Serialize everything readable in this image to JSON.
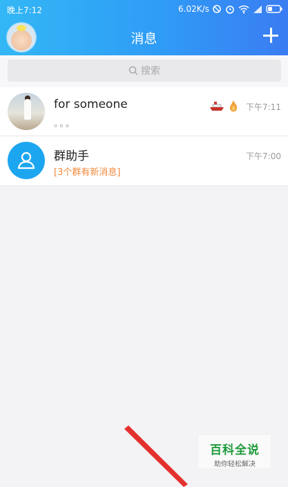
{
  "status": {
    "time": "晚上7:12",
    "speed": "6.02K/s"
  },
  "header": {
    "title": "消息",
    "plus_icon": "plus-icon",
    "avatar_icon": "baby-avatar"
  },
  "search": {
    "placeholder": "搜索"
  },
  "conversations": [
    {
      "name": "for  someone",
      "preview": "。。。",
      "time": "下午7:11",
      "badges": [
        "ship-icon",
        "flame-icon"
      ]
    },
    {
      "name": "群助手",
      "preview": "[3个群有新消息]",
      "time": "下午7:00"
    }
  ],
  "watermark": {
    "title": "百科全说",
    "subtitle": "助你轻松解决"
  },
  "colors": {
    "header_start": "#33b7f5",
    "header_end": "#3a7cf2",
    "preview_orange": "#f0883a",
    "group_icon_bg": "#1da6f0",
    "watermark_green": "#1e9b3b",
    "arrow_red": "#e3312d"
  }
}
